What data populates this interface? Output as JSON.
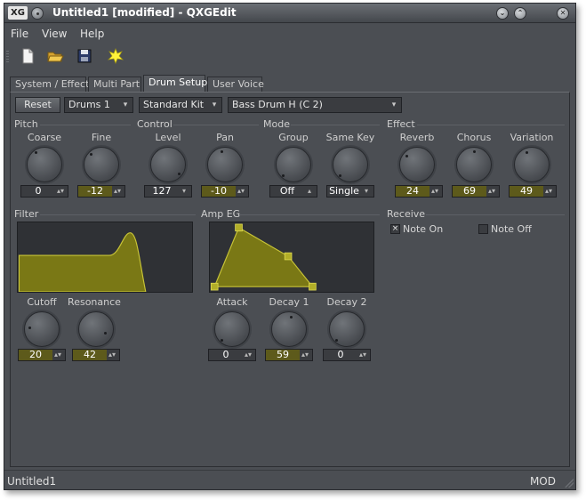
{
  "window": {
    "title": "Untitled1 [modified] - QXGEdit",
    "logo_text": "XG"
  },
  "menu": [
    "File",
    "View",
    "Help"
  ],
  "tabs": [
    "System / Effect",
    "Multi Part",
    "Drum Setup",
    "User Voice"
  ],
  "active_tab": "Drum Setup",
  "header": {
    "reset_label": "Reset",
    "part_select": "Drums 1",
    "kit_select": "Standard Kit",
    "note_select": "Bass Drum H (C  2)"
  },
  "pitch": {
    "title": "Pitch",
    "coarse": {
      "label": "Coarse",
      "value": "0"
    },
    "fine": {
      "label": "Fine",
      "value": "-12"
    }
  },
  "control": {
    "title": "Control",
    "level": {
      "label": "Level",
      "value": "127"
    },
    "pan": {
      "label": "Pan",
      "value": "-10"
    }
  },
  "mode": {
    "title": "Mode",
    "group": {
      "label": "Group",
      "value": "Off"
    },
    "same_key": {
      "label": "Same Key",
      "value": "Single"
    }
  },
  "effect": {
    "title": "Effect",
    "reverb": {
      "label": "Reverb",
      "value": "24"
    },
    "chorus": {
      "label": "Chorus",
      "value": "69"
    },
    "variation": {
      "label": "Variation",
      "value": "49"
    }
  },
  "filter": {
    "title": "Filter",
    "cutoff": {
      "label": "Cutoff",
      "value": "20"
    },
    "resonance": {
      "label": "Resonance",
      "value": "42"
    }
  },
  "amp_eg": {
    "title": "Amp EG",
    "attack": {
      "label": "Attack",
      "value": "0"
    },
    "decay1": {
      "label": "Decay 1",
      "value": "59"
    },
    "decay2": {
      "label": "Decay 2",
      "value": "0"
    }
  },
  "receive": {
    "title": "Receive",
    "note_on": {
      "label": "Note On",
      "checked": true
    },
    "note_off": {
      "label": "Note Off",
      "checked": false
    }
  },
  "status": {
    "left": "Untitled1",
    "right": "MOD"
  },
  "colors": {
    "accent": "#8c8a1c",
    "background": "#4b4e53"
  }
}
